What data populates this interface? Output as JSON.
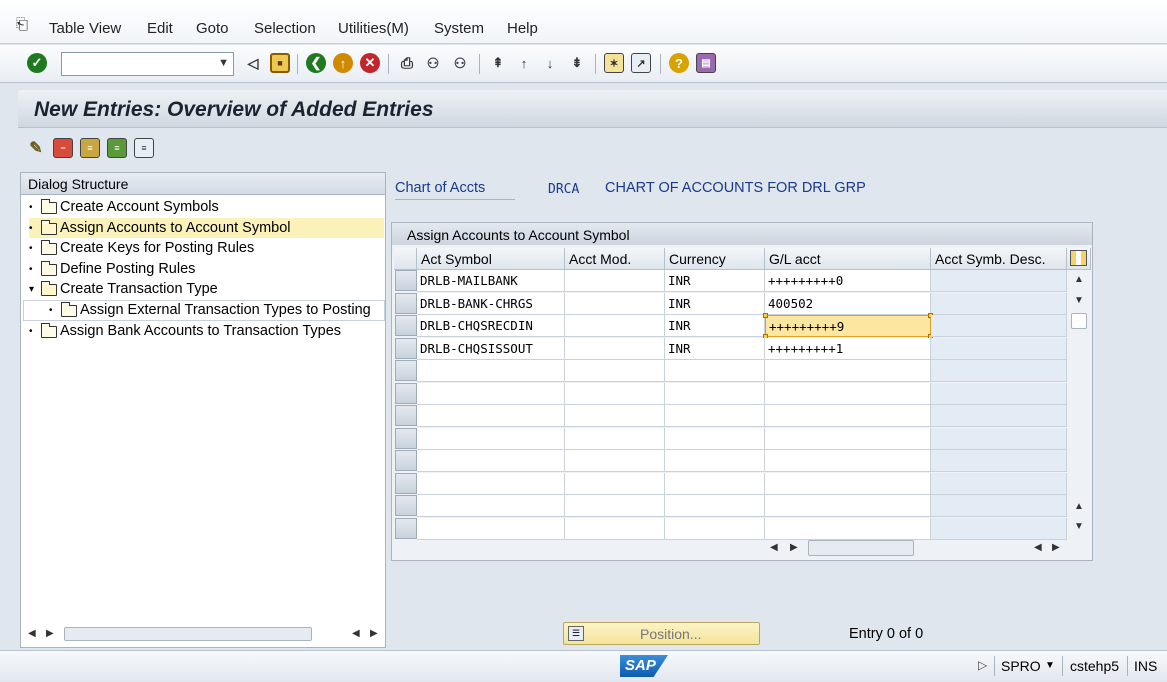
{
  "menu": {
    "items": [
      "Table View",
      "Edit",
      "Goto",
      "Selection",
      "Utilities(M)",
      "System",
      "Help"
    ]
  },
  "toolbar": {
    "command_field_value": "",
    "colors": {
      "enter": "#1f7a1f",
      "back": "#1f7a1f",
      "exit": "#d08a00",
      "cancel": "#c0262c",
      "help": "#d8a200"
    }
  },
  "page": {
    "title": "New Entries: Overview of Added Entries"
  },
  "dialog_structure": {
    "header": "Dialog Structure",
    "items": [
      {
        "label": "Create Account Symbols",
        "level": 0,
        "selected": false
      },
      {
        "label": "Assign Accounts to Account Symbol",
        "level": 0,
        "selected": true
      },
      {
        "label": "Create Keys for Posting Rules",
        "level": 0,
        "selected": false
      },
      {
        "label": "Define Posting Rules",
        "level": 0,
        "selected": false
      },
      {
        "label": "Create Transaction Type",
        "level": 0,
        "selected": false
      },
      {
        "label": "Assign External Transaction Types to Posting",
        "level": 1,
        "selected": false
      },
      {
        "label": "Assign Bank Accounts to Transaction Types",
        "level": 0,
        "selected": false
      }
    ]
  },
  "chart_of_accounts": {
    "label": "Chart of Accts",
    "code": "DRCA",
    "description": "CHART OF ACCOUNTS FOR DRL GRP"
  },
  "table": {
    "title": "Assign Accounts to Account Symbol",
    "columns": [
      "Act Symbol",
      "Acct Mod.",
      "Currency",
      "G/L acct",
      "Acct Symb. Desc."
    ],
    "rows": [
      [
        "DRLB-MAILBANK",
        "",
        "INR",
        "+++++++++0",
        ""
      ],
      [
        "DRLB-BANK-CHRGS",
        "",
        "INR",
        "400502",
        ""
      ],
      [
        "DRLB-CHQSRECDIN",
        "",
        "INR",
        "+++++++++9",
        ""
      ],
      [
        "DRLB-CHQSISSOUT",
        "",
        "INR",
        "+++++++++1",
        ""
      ]
    ],
    "empty_rows": 8
  },
  "footer": {
    "position_label": "Position...",
    "entry_count": "Entry 0 of 0"
  },
  "status": {
    "logo": "SAP",
    "transaction": "SPRO",
    "server": "cstehp5",
    "mode": "INS"
  }
}
